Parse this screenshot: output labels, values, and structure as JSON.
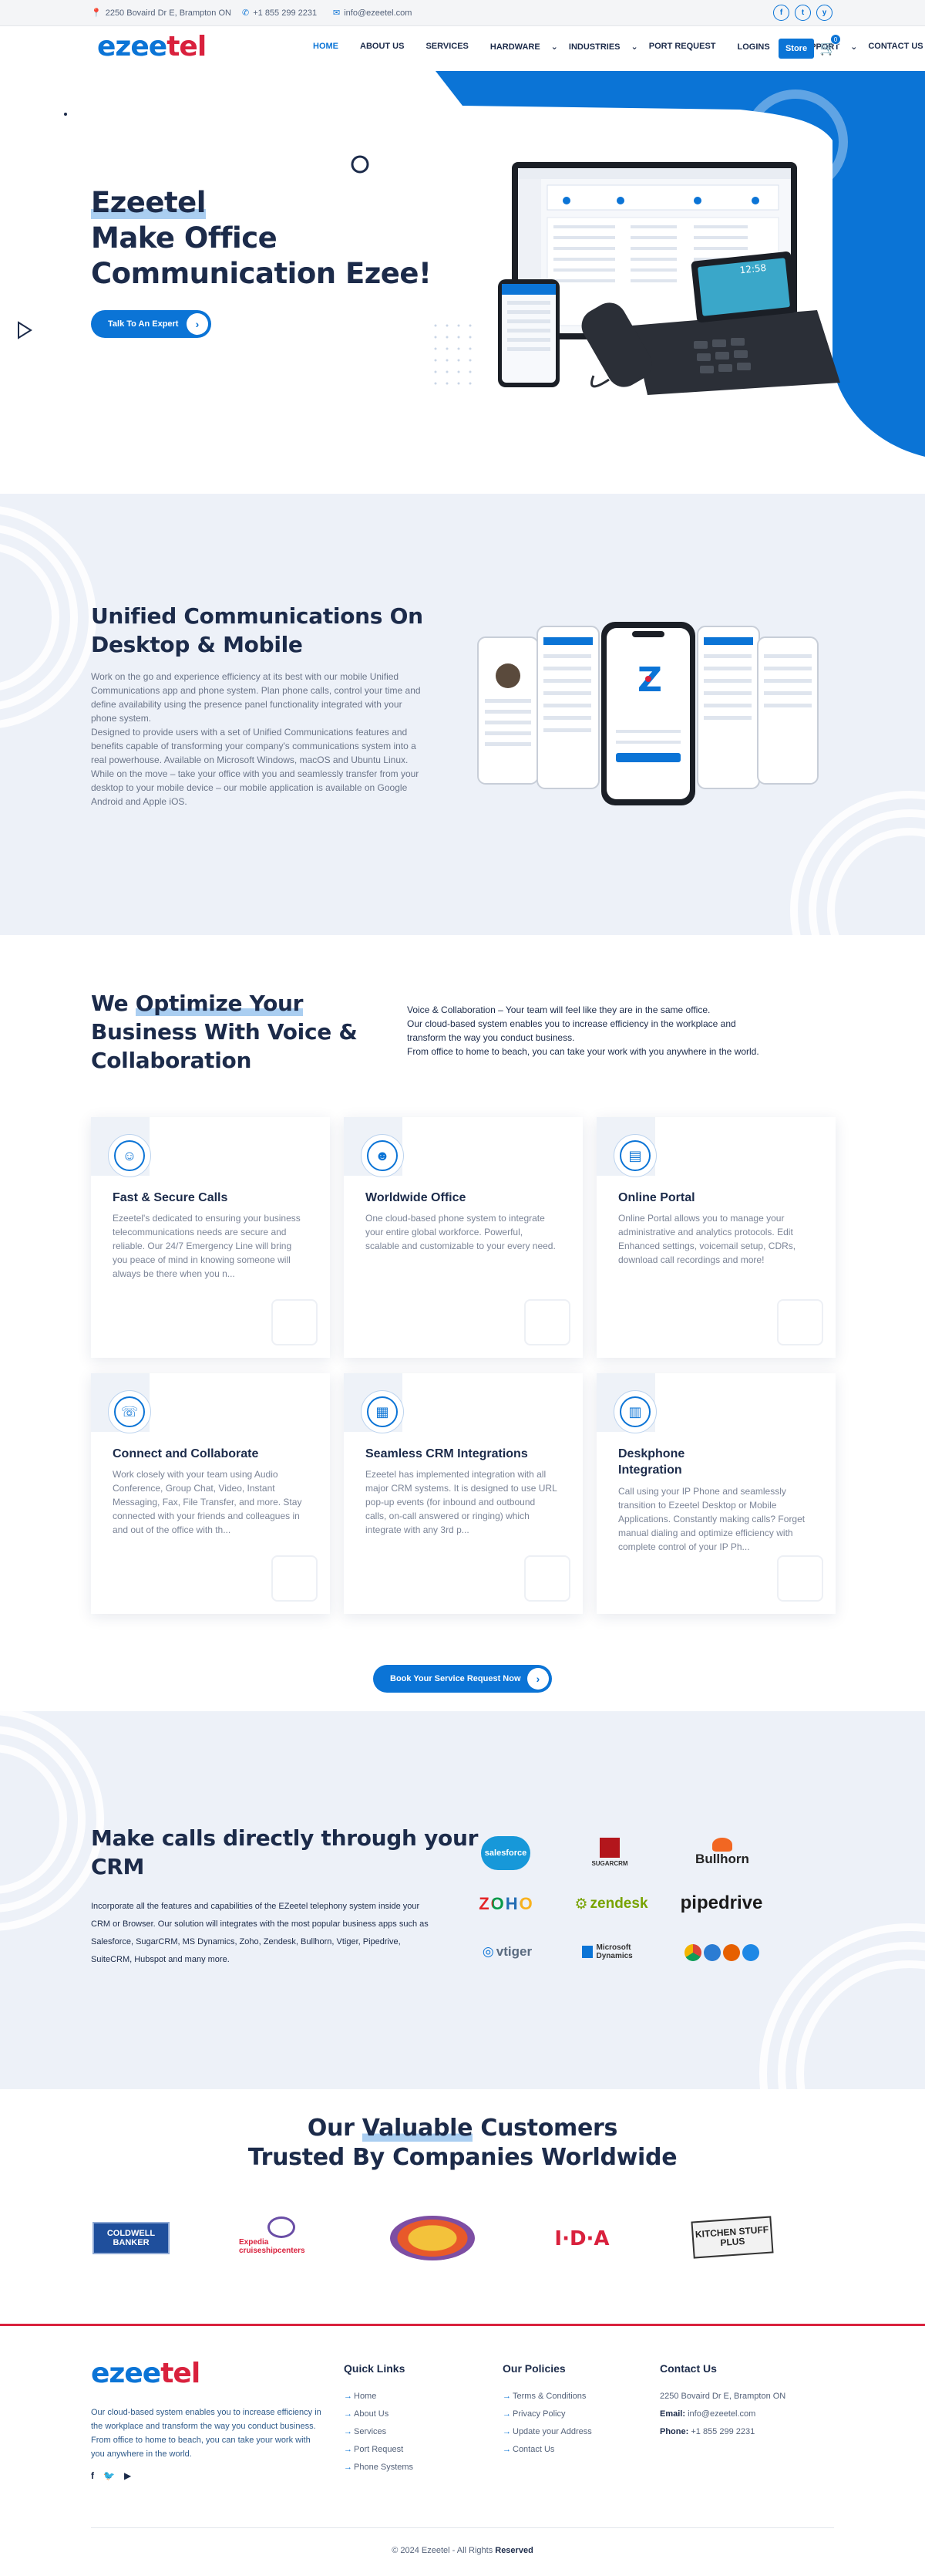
{
  "topbar": {
    "address": "2250 Bovaird Dr E, Brampton ON",
    "phone": "+1 855 299 2231",
    "email": "info@ezeetel.com",
    "social": [
      "f",
      "t",
      "y"
    ]
  },
  "brand": {
    "logo_a": "ezee",
    "logo_b": "tel"
  },
  "nav": {
    "items": [
      "HOME",
      "ABOUT US",
      "SERVICES",
      "HARDWARE",
      "INDUSTRIES",
      "PORT REQUEST",
      "LOGINS",
      "SUPPORT",
      "CONTACT US"
    ],
    "dropdown_marks": [
      "",
      "",
      "",
      "⌄",
      "⌄",
      "",
      "⌄",
      "⌄",
      ""
    ],
    "store_label": "Store",
    "cart_count": "0"
  },
  "hero": {
    "line1": "Ezeetel",
    "line2": "Make Office",
    "line3": "Communication Ezee!",
    "cta_label": "Talk To An Expert",
    "phone_display": "12:58"
  },
  "uc": {
    "title_line1": "Unified Communications On",
    "title_line2": "Desktop & Mobile",
    "paragraphs": [
      "Work on the go and experience efficiency at its best with our mobile Unified Communications app and phone system. Plan phone calls, control your time and define availability using the presence panel functionality integrated with your phone system.",
      "Designed to provide users with a set of Unified Communications features and benefits capable of transforming your company's communications system into a real powerhouse. Available on Microsoft Windows, macOS and Ubuntu Linux.",
      "While on the move – take your office with you and seamlessly transfer from your desktop to your mobile device – our mobile application is available on Google Android and Apple iOS."
    ]
  },
  "optimize": {
    "title_line1_a": "We ",
    "title_line1_b": "Optimize Your",
    "title_line2": "Business With Voice &",
    "title_line3": "Collaboration",
    "desc_lines": [
      "Voice & Collaboration – Your team will feel like they are in the same office.",
      "Our cloud-based system enables you to increase efficiency in the workplace and",
      "transform the way you conduct business.",
      "From office to home to beach, you can take your work with you anywhere in the world."
    ]
  },
  "cards": [
    {
      "title": "Fast & Secure Calls",
      "icon": "secure-calls-icon",
      "text": "Ezeetel's dedicated to ensuring your business telecommunications needs are secure and reliable. Our 24/7 Emergency Line will bring you peace of mind in knowing someone will always be there when you n..."
    },
    {
      "title": "Worldwide Office",
      "icon": "worldwide-office-icon",
      "text": "One cloud-based phone system to integrate your entire global workforce. Powerful, scalable and customizable to your every need."
    },
    {
      "title": "Online Portal",
      "icon": "online-portal-icon",
      "text": "Online Portal allows you to manage your administrative and analytics protocols. Edit Enhanced settings, voicemail setup, CDRs, download call recordings and more!"
    },
    {
      "title": "Connect and Collaborate",
      "icon": "collaborate-icon",
      "text": "Work closely with your team using Audio Conference, Group Chat, Video, Instant Messaging, Fax, File Transfer, and more. Stay connected with your friends and colleagues in and out of the office with th..."
    },
    {
      "title": "Seamless CRM Integrations",
      "icon": "crm-integration-icon",
      "text": "Ezeetel has implemented integration with all major CRM systems. It is designed to use URL pop-up events (for inbound and outbound calls, on-call answered or ringing) which integrate with any 3rd p..."
    },
    {
      "title": "Deskphone Integration",
      "icon": "deskphone-icon",
      "text": "Call using your IP Phone and seamlessly transition to Ezeetel Desktop or Mobile Applications. Constantly making calls? Forget manual dialing and optimize efficiency with complete control of your IP Ph..."
    }
  ],
  "service_cta": "Book Your Service Request Now",
  "crm": {
    "title_line1": "Make calls directly through your",
    "title_line2": "CRM",
    "text": "Incorporate all the features and capabilities of the EZeetel telephony system inside your CRM or Browser. Our solution will integrates with the most popular business apps such as Salesforce, SugarCRM, MS Dynamics, Zoho, Zendesk, Bullhorn, Vtiger, Pipedrive, SuiteCRM, Hubspot and many more.",
    "logos": [
      "salesforce",
      "SUGARCRM",
      "Bullhorn",
      "ZOHO",
      "zendesk",
      "pipedrive",
      "vtiger",
      "Microsoft Dynamics",
      ""
    ]
  },
  "customers": {
    "title_a": "Our ",
    "title_b": "Valuable",
    "title_c": " Customers",
    "title_line2": "Trusted By Companies Worldwide",
    "logos": [
      "COLDWELL BANKER",
      "Expedia cruiseshipcenters",
      "",
      "I·D·A",
      "KITCHEN STUFF PLUS"
    ]
  },
  "footer": {
    "about": "Our cloud-based system enables you to increase efficiency in the workplace and transform the way you conduct business. From office to home to beach, you can take your work with you anywhere in the world.",
    "quick_title": "Quick Links",
    "quick": [
      "Home",
      "About Us",
      "Services",
      "Port Request",
      "Phone Systems"
    ],
    "policy_title": "Our Policies",
    "policies": [
      "Terms & Conditions",
      "Privacy Policy",
      "Update your Address",
      "Contact Us"
    ],
    "contact_title": "Contact Us",
    "contact_address": "2250 Bovaird Dr E, Brampton ON",
    "email_label": "Email:",
    "email": "info@ezeetel.com",
    "phone_label": "Phone:",
    "phone": "+1 855 299 2231",
    "copyright_a": "© 2024 Ezeetel - All Rights ",
    "copyright_b": "Reserved"
  },
  "colors": {
    "accent": "#0b74d6",
    "brand_red": "#d9213d",
    "navy": "#1c2b4a",
    "section_bg": "#edf1f8"
  }
}
